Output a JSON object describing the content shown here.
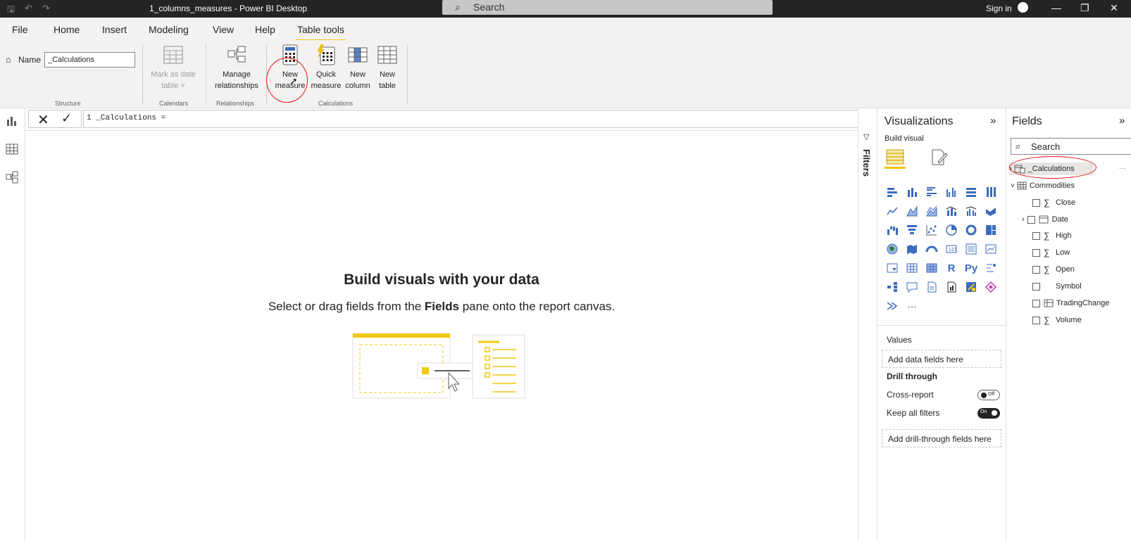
{
  "titlebar": {
    "doc_title": "1_columns_measures - Power BI Desktop",
    "search_label": "Search",
    "sign_in": "Sign in",
    "minimize": "—",
    "restore": "❐",
    "close": "✕"
  },
  "tabs": [
    "File",
    "Home",
    "Insert",
    "Modeling",
    "View",
    "Help",
    "Table tools"
  ],
  "ribbon": {
    "name_label": "Name",
    "name_value": "_Calculations",
    "mark_as_date_table": [
      "Mark as date",
      "table ˅"
    ],
    "manage_relationships": [
      "Manage",
      "relationships"
    ],
    "new_measure": [
      "New",
      "measure"
    ],
    "quick_measure": [
      "Quick",
      "measure"
    ],
    "new_column": [
      "New",
      "column"
    ],
    "new_table": [
      "New",
      "table"
    ],
    "groups": {
      "structure": "Structure",
      "calendars": "Calendars",
      "relationships": "Relationships",
      "calculations": "Calculations"
    }
  },
  "formula": {
    "text": "1  _Calculations ="
  },
  "canvas": {
    "title": "Build visuals with your data",
    "subtitle_before": "Select or drag fields from the ",
    "subtitle_bold": "Fields",
    "subtitle_after": " pane onto the report canvas."
  },
  "filters": {
    "label": "Filters"
  },
  "viz": {
    "title": "Visualizations",
    "build_visual": "Build visual",
    "r_label": "R",
    "py_label": "Py",
    "more": "···",
    "values_label": "Values",
    "add_data_fields": "Add data fields here",
    "drill_through": "Drill through",
    "cross_report": "Cross-report",
    "cross_report_state": "Off",
    "keep_all_filters": "Keep all filters",
    "keep_all_filters_state": "On",
    "add_drill_through": "Add drill-through fields here"
  },
  "fields": {
    "title": "Fields",
    "search_placeholder": "Search",
    "tables": [
      {
        "name": "_Calculations",
        "expanded": false
      },
      {
        "name": "Commodities",
        "expanded": true
      }
    ],
    "columns": [
      "Close",
      "Date",
      "High",
      "Low",
      "Open",
      "Symbol",
      "TradingChange",
      "Volume"
    ]
  },
  "colors": {
    "accent": "#f2c811",
    "annotation": "#e5141b",
    "titlebar": "#252423",
    "ribbon": "#f3f2f1"
  }
}
